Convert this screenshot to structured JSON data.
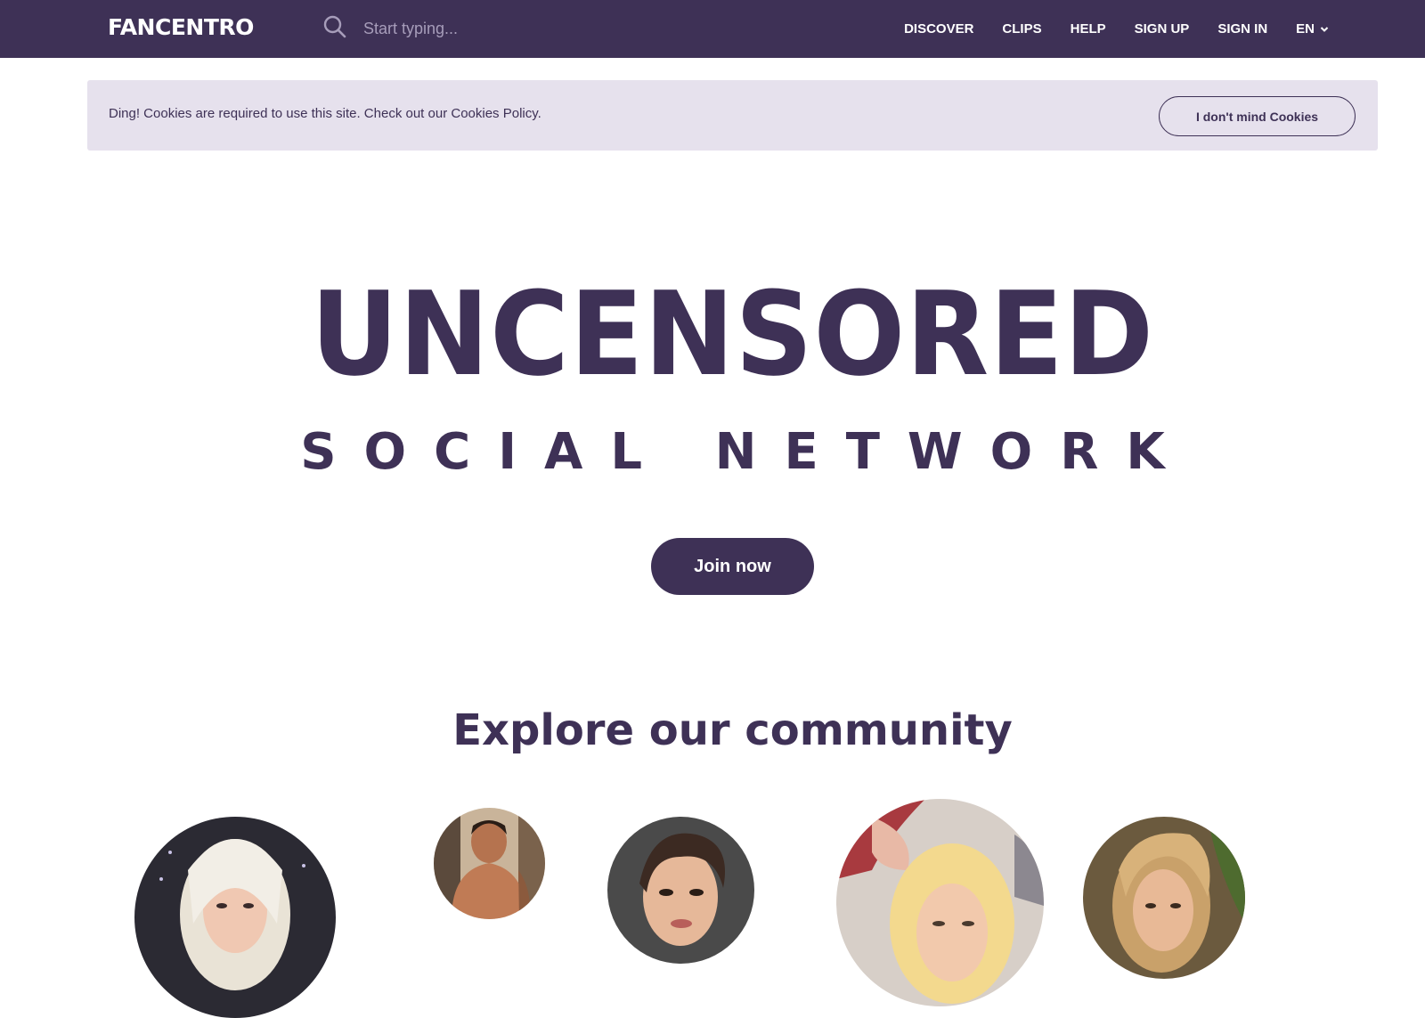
{
  "header": {
    "logo": "FANCENTRO",
    "search_placeholder": "Start typing...",
    "nav": {
      "discover": "DISCOVER",
      "clips": "CLIPS",
      "help": "HELP",
      "sign_up": "SIGN UP",
      "sign_in": "SIGN IN",
      "language": "EN"
    }
  },
  "cookie_banner": {
    "message": "Ding! Cookies are required to use this site. Check out our Cookies Policy.",
    "accept_label": "I don't mind Cookies"
  },
  "hero": {
    "title": "UNCENSORED",
    "subtitle": "SOCIAL NETWORK",
    "cta_label": "Join now"
  },
  "community": {
    "title": "Explore our community",
    "avatar_count": 5
  },
  "colors": {
    "brand_purple": "#3e3156",
    "banner_bg": "#e6e1ed",
    "placeholder": "#a79dba"
  }
}
